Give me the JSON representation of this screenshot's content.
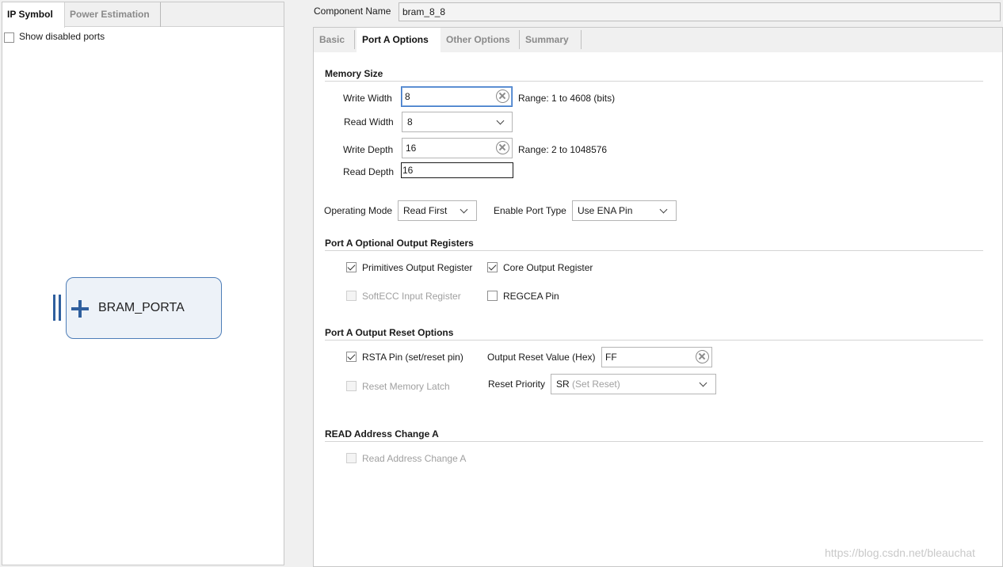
{
  "left_pane": {
    "tabs": [
      "IP Symbol",
      "Power Estimation"
    ],
    "active_tab": "IP Symbol",
    "show_disabled_ports": {
      "label": "Show disabled ports",
      "checked": false
    },
    "symbol": {
      "name": "BRAM_PORTA"
    }
  },
  "component_name": {
    "label": "Component Name",
    "value": "bram_8_8"
  },
  "tabs": [
    "Basic",
    "Port A Options",
    "Other Options",
    "Summary"
  ],
  "active_tab": "Port A Options",
  "memory_size": {
    "title": "Memory Size",
    "write_width": {
      "label": "Write Width",
      "value": "8",
      "range": "Range: 1 to 4608 (bits)"
    },
    "read_width": {
      "label": "Read Width",
      "value": "8"
    },
    "write_depth": {
      "label": "Write Depth",
      "value": "16",
      "range": "Range: 2 to 1048576"
    },
    "read_depth": {
      "label": "Read Depth",
      "value": "16"
    }
  },
  "operating_mode": {
    "label": "Operating Mode",
    "value": "Read First"
  },
  "enable_port_type": {
    "label": "Enable Port Type",
    "value": "Use ENA Pin"
  },
  "optional_output_registers": {
    "title": "Port A Optional Output Registers",
    "primitives": {
      "label": "Primitives Output Register",
      "checked": true,
      "enabled": true
    },
    "core": {
      "label": "Core Output Register",
      "checked": true,
      "enabled": true
    },
    "softecc": {
      "label": "SoftECC Input Register",
      "checked": false,
      "enabled": false
    },
    "regcea": {
      "label": "REGCEA Pin",
      "checked": false,
      "enabled": true
    }
  },
  "output_reset": {
    "title": "Port A Output Reset Options",
    "rsta": {
      "label": "RSTA Pin (set/reset pin)",
      "checked": true,
      "enabled": true
    },
    "reset_value": {
      "label": "Output Reset Value (Hex)",
      "value": "FF"
    },
    "reset_memory_latch": {
      "label": "Reset Memory Latch",
      "checked": false,
      "enabled": false
    },
    "reset_priority": {
      "label": "Reset Priority",
      "value": "SR",
      "value_hint": "(Set Reset)"
    }
  },
  "read_address_change": {
    "title": "READ Address Change A",
    "checkbox": {
      "label": "Read Address Change A",
      "checked": false,
      "enabled": false
    }
  },
  "watermark": "https://blog.csdn.net/bleauchat"
}
